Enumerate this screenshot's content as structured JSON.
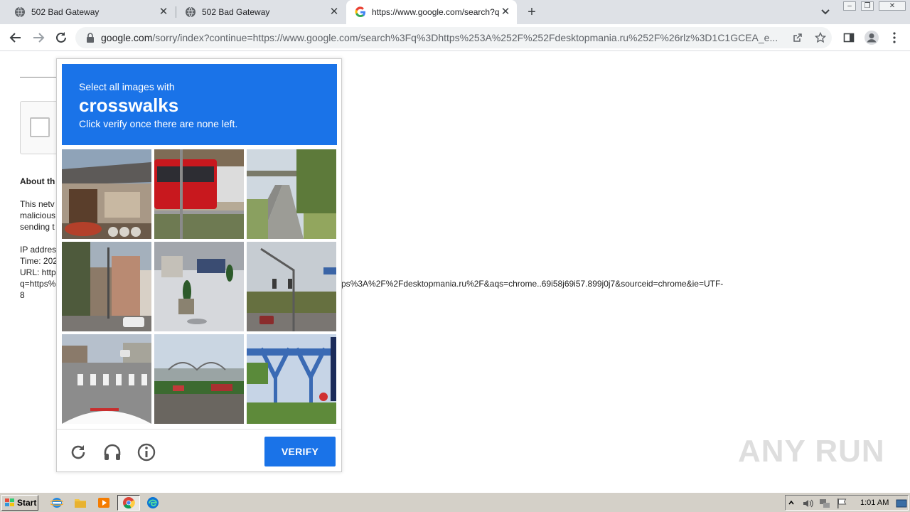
{
  "tabs": [
    {
      "title": "502 Bad Gateway",
      "active": false
    },
    {
      "title": "502 Bad Gateway",
      "active": false
    },
    {
      "title": "https://www.google.com/search?q=",
      "active": true
    }
  ],
  "toolbar": {
    "url_host": "google.com",
    "url_rest": "/sorry/index?continue=https://www.google.com/search%3Fq%3Dhttps%253A%252F%252Fdesktopmania.ru%252F%26rlz%3D1C1GCEA_e..."
  },
  "page": {
    "about_heading": "About th",
    "lines": [
      "This netv",
      "malicious",
      "sending t",
      "IP addres",
      "Time: 202",
      "URL: http",
      "q=https%",
      "8"
    ],
    "url_continuation": "ps%3A%2F%2Fdesktopmania.ru%2F&aqs=chrome..69i58j69i57.899j0j7&sourceid=chrome&ie=UTF-"
  },
  "captcha": {
    "instruction_line1": "Select all images with",
    "target_object": "crosswalks",
    "instruction_line3": "Click verify once there are none left.",
    "verify_label": "VERIFY",
    "tiles": [
      "japanese-house",
      "red-bus",
      "road-bridge",
      "narrow-street",
      "plaza-planters",
      "traffic-light-intersection",
      "crosswalk-street",
      "highway-bridge",
      "blue-gantry"
    ]
  },
  "watermark": "ANY RUN",
  "taskbar": {
    "start_label": "Start",
    "clock": "1:01 AM"
  },
  "colors": {
    "captcha_blue": "#1a73e8",
    "tabstrip": "#dee1e6",
    "taskbar": "#d4d0c8"
  }
}
